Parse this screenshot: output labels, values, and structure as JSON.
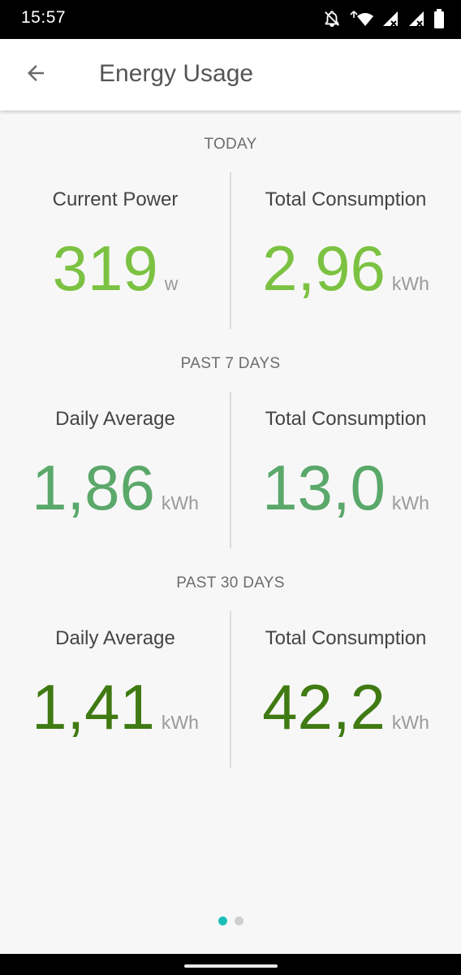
{
  "status": {
    "time": "15:57",
    "icons": [
      "notifications-off-icon",
      "wifi-icon",
      "signal-icon",
      "signal-icon",
      "battery-icon"
    ]
  },
  "appbar": {
    "title": "Energy Usage",
    "back_icon": "arrow-left-icon"
  },
  "sections": [
    {
      "header": "TODAY",
      "left": {
        "label": "Current Power",
        "value": "319",
        "unit": "w"
      },
      "right": {
        "label": "Total Consumption",
        "value": "2,96",
        "unit": "kWh"
      },
      "color": "#7cc242"
    },
    {
      "header": "PAST 7 DAYS",
      "left": {
        "label": "Daily Average",
        "value": "1,86",
        "unit": "kWh"
      },
      "right": {
        "label": "Total Consumption",
        "value": "13,0",
        "unit": "kWh"
      },
      "color": "#5aa86a"
    },
    {
      "header": "PAST 30 DAYS",
      "left": {
        "label": "Daily Average",
        "value": "1,41",
        "unit": "kWh"
      },
      "right": {
        "label": "Total Consumption",
        "value": "42,2",
        "unit": "kWh"
      },
      "color": "#3f7a12"
    }
  ],
  "pager": {
    "active_color": "#1bbfb7",
    "inactive_color": "#cfcfcf"
  }
}
